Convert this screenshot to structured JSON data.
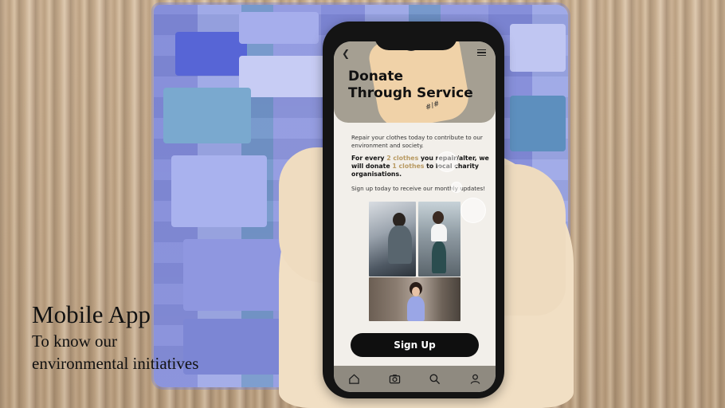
{
  "app": {
    "hero": {
      "title_line1": "Donate",
      "title_line2": "Through Service",
      "back_icon": "chevron-left-icon",
      "menu_icon": "hamburger-menu-icon"
    },
    "intro_text": "Repair your clothes today to contribute to our environment and society.",
    "pledge": {
      "part1": "For every ",
      "highlight1": "2 clothes",
      "part2": " you repair/alter, we will donate ",
      "highlight2": "1 clothes",
      "part3": " to local charity organisations."
    },
    "signup_note": "Sign up today to receive our monthly updates!",
    "signup_button": "Sign Up",
    "tabbar": {
      "items": [
        "home-icon",
        "camera-icon",
        "search-icon",
        "profile-icon"
      ]
    },
    "colors": {
      "hero_bg": "#a59f92",
      "highlight": "#b89a62",
      "button_bg": "#0f0f0f",
      "tabbar_bg": "#8f8a80"
    }
  },
  "caption": {
    "title": "Mobile App",
    "line1": "To know our",
    "line2": "environmental initiatives"
  }
}
